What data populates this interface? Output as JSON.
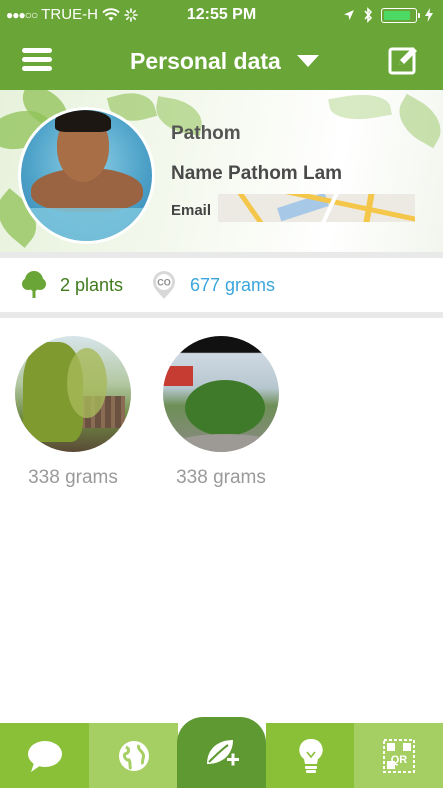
{
  "status_bar": {
    "signal_dots": "●●●○○",
    "carrier": "TRUE-H",
    "time": "12:55 PM"
  },
  "nav": {
    "title": "Personal data"
  },
  "profile": {
    "nickname": "Pathom",
    "full_name": "Name Pathom Lam",
    "email_label": "Email"
  },
  "stats": {
    "plants": "2 plants",
    "co2_icon_text": "CO",
    "grams": "677 grams"
  },
  "plants": [
    {
      "grams": "338 grams"
    },
    {
      "grams": "338 grams"
    }
  ],
  "tabbar": {
    "qr_text": "QR",
    "icons": [
      "chat-bubble-icon",
      "globe-icon",
      "add-plant-icon",
      "lightbulb-icon",
      "qr-code-icon"
    ]
  },
  "colors": {
    "brand_green": "#6aa637",
    "dark_green_text": "#3f7b1c",
    "blue_text": "#3ba6dc",
    "battery_green": "#4cd964"
  }
}
